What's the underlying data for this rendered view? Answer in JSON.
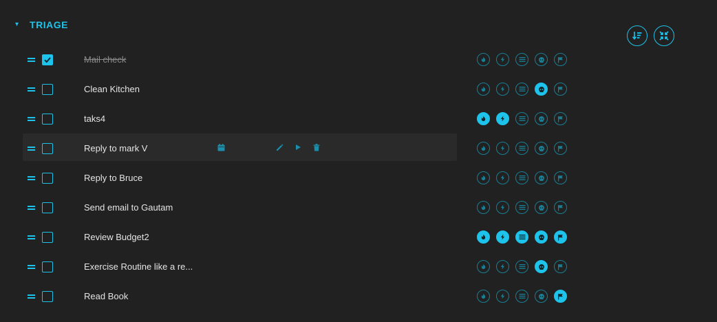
{
  "section": {
    "title": "TRIAGE"
  },
  "colors": {
    "accent": "#1ec3ec",
    "dim": "#1a7f95",
    "background": "#212121"
  },
  "toolbar": {
    "sort_icon": "sort-icon",
    "collapse_icon": "collapse-icon"
  },
  "priority_icons": [
    "urgent-icon",
    "energy-icon",
    "effort-icon",
    "dread-icon",
    "flag-icon"
  ],
  "tasks": [
    {
      "label": "Mail check",
      "done": true,
      "flags": [
        false,
        false,
        false,
        false,
        false
      ]
    },
    {
      "label": "Clean Kitchen",
      "done": false,
      "flags": [
        false,
        false,
        false,
        true,
        false
      ]
    },
    {
      "label": "taks4",
      "done": false,
      "flags": [
        true,
        true,
        false,
        false,
        false
      ]
    },
    {
      "label": "Reply to mark V",
      "done": false,
      "flags": [
        false,
        false,
        false,
        false,
        false
      ],
      "hovered": true
    },
    {
      "label": "Reply to Bruce",
      "done": false,
      "flags": [
        false,
        false,
        false,
        false,
        false
      ]
    },
    {
      "label": "Send email to Gautam",
      "done": false,
      "flags": [
        false,
        false,
        false,
        false,
        false
      ]
    },
    {
      "label": "Review Budget2",
      "done": false,
      "flags": [
        true,
        true,
        true,
        true,
        true
      ]
    },
    {
      "label": "Exercise Routine like a re...",
      "done": false,
      "flags": [
        false,
        false,
        false,
        true,
        false
      ]
    },
    {
      "label": "Read Book",
      "done": false,
      "flags": [
        false,
        false,
        false,
        false,
        true
      ]
    }
  ]
}
